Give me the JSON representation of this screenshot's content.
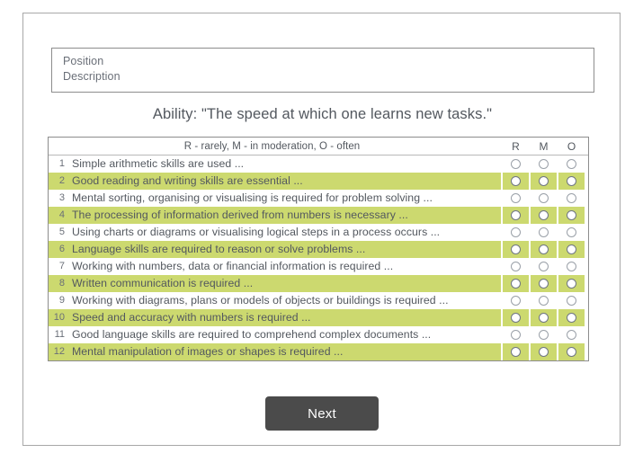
{
  "form": {
    "position_label": "Position",
    "description_label": "Description"
  },
  "title": "Ability: \"The speed at which one learns new tasks.\"",
  "table": {
    "legend": "R - rarely, M - in moderation, O - often",
    "columns": {
      "r": "R",
      "m": "M",
      "o": "O"
    },
    "rows": [
      {
        "num": "1",
        "text": "Simple arithmetic skills are used ...",
        "highlighted": false
      },
      {
        "num": "2",
        "text": "Good reading and writing skills are essential ...",
        "highlighted": true
      },
      {
        "num": "3",
        "text": "Mental sorting, organising or visualising is required for problem solving ...",
        "highlighted": false
      },
      {
        "num": "4",
        "text": "The processing of information derived from numbers is necessary ...",
        "highlighted": true
      },
      {
        "num": "5",
        "text": "Using charts or diagrams or visualising logical steps in a process occurs ...",
        "highlighted": false
      },
      {
        "num": "6",
        "text": "Language skills are required to reason or solve problems ...",
        "highlighted": true
      },
      {
        "num": "7",
        "text": "Working with numbers, data or financial information is required ...",
        "highlighted": false
      },
      {
        "num": "8",
        "text": "Written communication is required ...",
        "highlighted": true
      },
      {
        "num": "9",
        "text": "Working with diagrams, plans or models of objects or buildings is required ...",
        "highlighted": false
      },
      {
        "num": "10",
        "text": "Speed and accuracy with numbers is required ...",
        "highlighted": true
      },
      {
        "num": "11",
        "text": "Good language skills are required to comprehend complex documents ...",
        "highlighted": false
      },
      {
        "num": "12",
        "text": "Mental manipulation of images or shapes is required ...",
        "highlighted": true
      }
    ]
  },
  "actions": {
    "next_label": "Next"
  },
  "colors": {
    "highlight_green": "#ccd96f",
    "button_dark": "#4b4b4b",
    "text_gray": "#53585f",
    "border_gray": "#8d8d8d"
  }
}
